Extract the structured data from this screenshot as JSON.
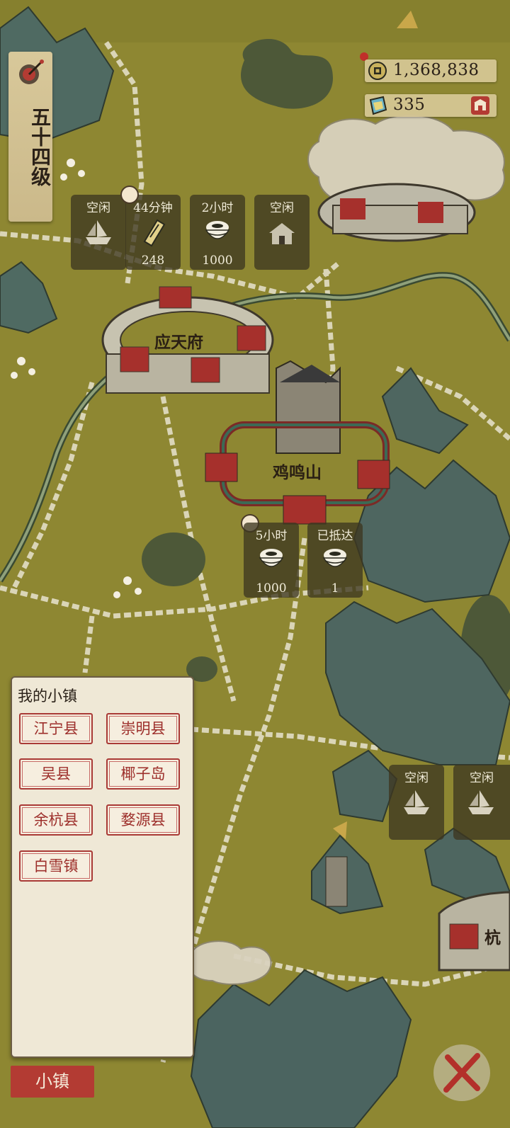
{
  "level": {
    "label": "五十四级"
  },
  "currency": {
    "coins": "1,368,838",
    "gems": "335"
  },
  "top_tasks": [
    {
      "status": "空闲",
      "icon": "boat-icon",
      "count": ""
    },
    {
      "status": "44分钟",
      "icon": "scroll-icon",
      "count": "248"
    },
    {
      "status": "2小时",
      "icon": "rice-bowl-icon",
      "count": "1000"
    },
    {
      "status": "空闲",
      "icon": "building-icon",
      "count": ""
    }
  ],
  "mid_tasks": [
    {
      "status": "5小时",
      "icon": "rice-bowl-icon",
      "count": "1000"
    },
    {
      "status": "已抵达",
      "icon": "rice-bowl-icon",
      "count": "1"
    }
  ],
  "right_tasks": [
    {
      "status": "空闲",
      "icon": "boat-icon"
    },
    {
      "status": "空闲",
      "icon": "boat-icon"
    }
  ],
  "cities": {
    "yingtianfu": "应天府",
    "jimingshan": "鸡鸣山",
    "hang": "杭"
  },
  "town_panel": {
    "title": "我的小镇",
    "towns": [
      "江宁县",
      "崇明县",
      "吴县",
      "椰子岛",
      "余杭县",
      "婺源县",
      "白雪镇"
    ]
  },
  "bottom_tab": "小镇",
  "colors": {
    "map": "#8e8732",
    "red": "#b33b33",
    "panel": "#efe8d6"
  }
}
